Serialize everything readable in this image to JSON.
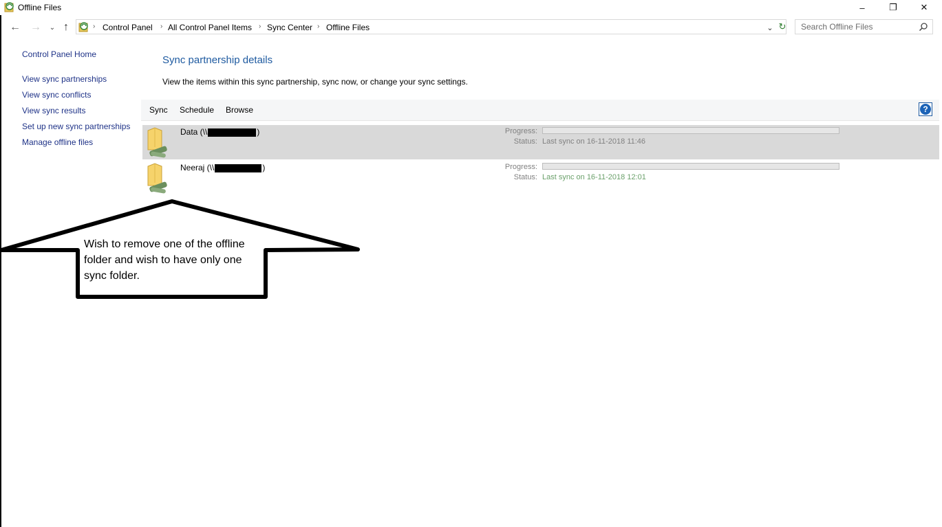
{
  "window": {
    "title": "Offline Files",
    "minimize": "–",
    "restore": "❐",
    "close": "✕"
  },
  "nav": {
    "back": "←",
    "forward": "→",
    "recent": "⌄",
    "up": "↑"
  },
  "address": {
    "breadcrumbs": [
      "Control Panel",
      "All Control Panel Items",
      "Sync Center",
      "Offline Files"
    ],
    "separator": "›",
    "dropdown": "⌄",
    "refresh": "↻"
  },
  "search": {
    "placeholder": "Search Offline Files"
  },
  "left_pane": {
    "home": "Control Panel Home",
    "links": [
      "View sync partnerships",
      "View sync conflicts",
      "View sync results",
      "Set up new sync partnerships",
      "Manage offline files"
    ]
  },
  "main": {
    "title": "Sync partnership details",
    "description": "View the items within this sync partnership, sync now, or change your sync settings.",
    "toolbar": {
      "sync": "Sync",
      "schedule": "Schedule",
      "browse": "Browse",
      "help": "?"
    },
    "items": [
      {
        "name_prefix": "Data (\\\\",
        "name_suffix": ")",
        "progress_label": "Progress:",
        "progress": 0,
        "status_label": "Status:",
        "status": "Last sync on 16-11-2018 11:46",
        "status_color": "#808080",
        "selected": true
      },
      {
        "name_prefix": "Neeraj (\\\\",
        "name_suffix": ")",
        "progress_label": "Progress:",
        "progress": 0,
        "status_label": "Status:",
        "status": "Last sync on 16-11-2018 12:01",
        "status_color": "#6aa06a",
        "selected": false
      }
    ]
  },
  "annotation": {
    "text": "Wish to remove one of the offline folder and wish to have only one sync folder."
  },
  "colors": {
    "link": "#1e3287",
    "title": "#1e5aa0",
    "selected_row": "#d9d9d9"
  }
}
